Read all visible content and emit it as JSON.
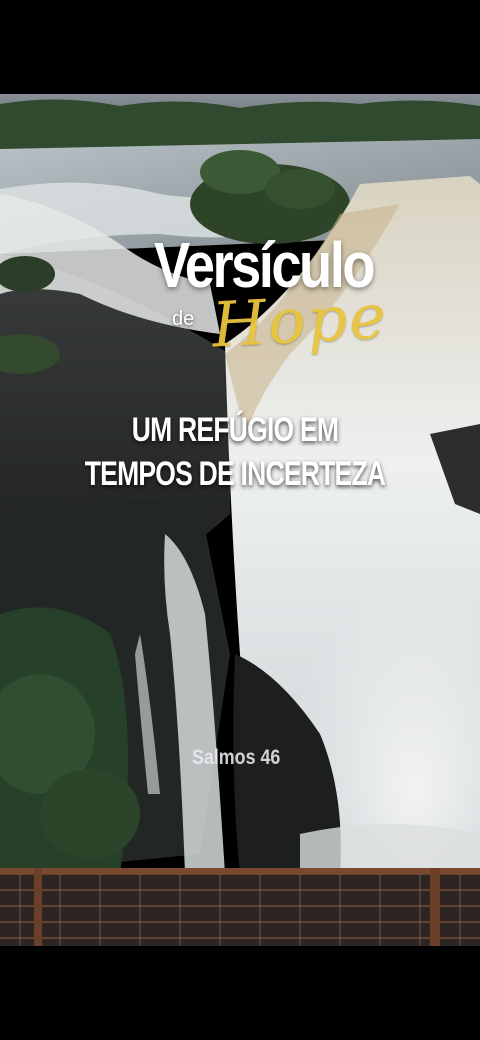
{
  "overlay": {
    "title": "Versículo",
    "connector": "de",
    "script_word": "Hope",
    "subtitle": "UM REFÚGIO EM TEMPOS DE INCERTEZA",
    "reference": "Salmos 46"
  },
  "colors": {
    "script_accent": "#e9c43a",
    "text": "#ffffff",
    "background": "#000000"
  }
}
